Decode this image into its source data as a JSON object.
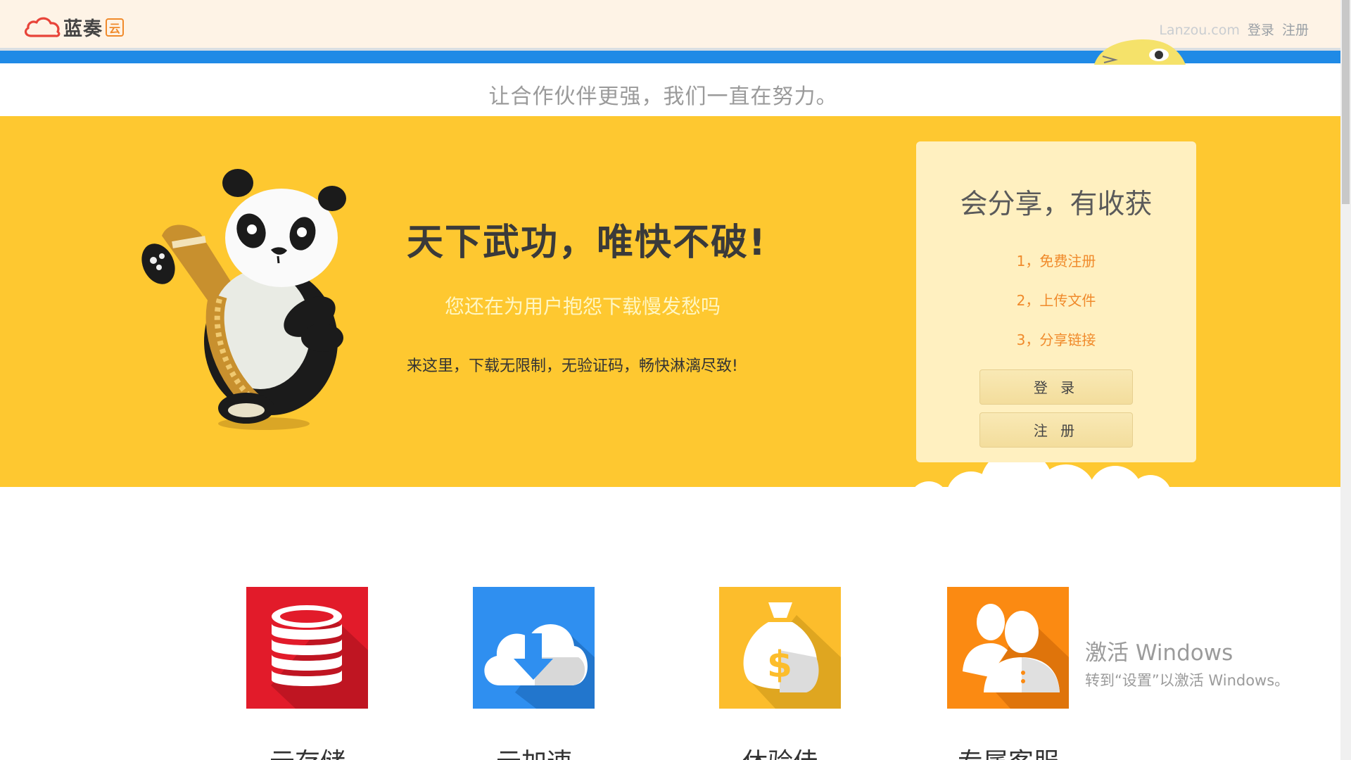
{
  "header": {
    "logo_text": "蓝奏",
    "logo_badge": "云",
    "domain": "Lanzou.com",
    "login_link": "登录",
    "register_link": "注册"
  },
  "tagline": "让合作伙伴更强，我们一直在努力。",
  "hero": {
    "title": "天下武功，唯快不破!",
    "subtitle": "您还在为用户抱怨下载慢发愁吗",
    "description": "来这里，下载无限制，无验证码，畅快淋漓尽致!"
  },
  "signup_card": {
    "title": "会分享，有收获",
    "steps": [
      "1，免费注册",
      "2，上传文件",
      "3，分享链接"
    ],
    "login_button": "登 录",
    "register_button": "注 册"
  },
  "features": [
    {
      "label": "云存储",
      "icon": "database-icon",
      "color": "#e21b2a"
    },
    {
      "label": "云加速",
      "icon": "cloud-download-icon",
      "color": "#2f8ff0"
    },
    {
      "label": "休验佳",
      "icon": "money-bag-icon",
      "color": "#fcbd2c"
    },
    {
      "label": "专属客服",
      "icon": "users-icon",
      "color": "#fb8a12"
    }
  ],
  "windows_activation": {
    "title": "激活 Windows",
    "subtitle": "转到“设置”以激活 Windows。"
  },
  "colors": {
    "header_bg": "#fef3e6",
    "accent_blue": "#1f8ae6",
    "hero_yellow": "#fec830",
    "card_bg": "#fff0c0",
    "step_orange": "#f08a2b"
  }
}
